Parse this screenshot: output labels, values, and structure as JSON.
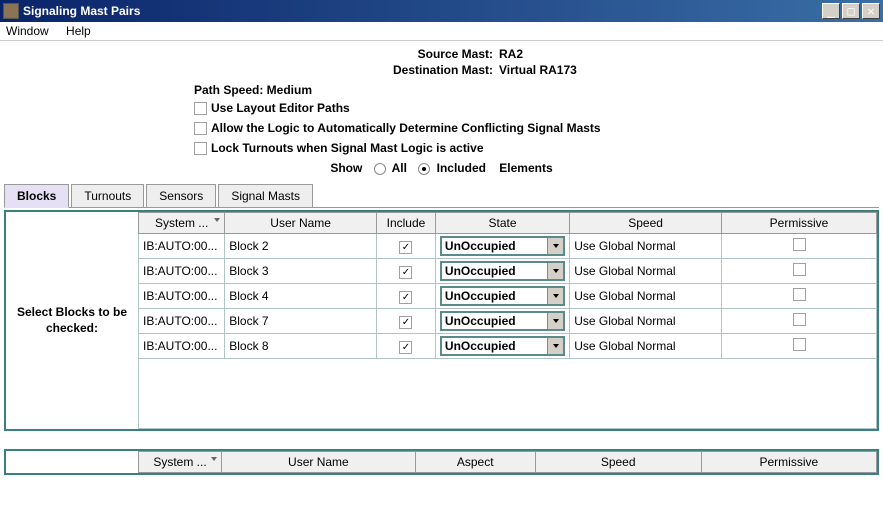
{
  "window": {
    "title": "Signaling Mast Pairs"
  },
  "menu": {
    "window": "Window",
    "help": "Help"
  },
  "header": {
    "src_label": "Source Mast:",
    "src_value": "RA2",
    "dst_label": "Destination Mast:",
    "dst_value": "Virtual RA173",
    "pathspeed": "Path Speed: Medium"
  },
  "options": {
    "useLayout": "Use Layout Editor Paths",
    "autoDetermine": "Allow the Logic to Automatically Determine Conflicting Signal Masts",
    "lockTurnouts": "Lock Turnouts when Signal Mast Logic is active"
  },
  "show": {
    "label": "Show",
    "all": "All",
    "included": "Included",
    "elements": "Elements"
  },
  "tabs": {
    "blocks": "Blocks",
    "turnouts": "Turnouts",
    "sensors": "Sensors",
    "masts": "Signal Masts"
  },
  "cols": {
    "sys": "System ...",
    "user": "User Name",
    "inc": "Include",
    "state": "State",
    "speed": "Speed",
    "perm": "Permissive",
    "aspect": "Aspect"
  },
  "sidecap": "Select Blocks to be checked:",
  "rows": [
    {
      "sys": "IB:AUTO:00...",
      "user": "Block 2",
      "state": "UnOccupied",
      "speed": "Use Global Normal"
    },
    {
      "sys": "IB:AUTO:00...",
      "user": "Block 3",
      "state": "UnOccupied",
      "speed": "Use Global Normal"
    },
    {
      "sys": "IB:AUTO:00...",
      "user": "Block 4",
      "state": "UnOccupied",
      "speed": "Use Global Normal"
    },
    {
      "sys": "IB:AUTO:00...",
      "user": "Block 7",
      "state": "UnOccupied",
      "speed": "Use Global Normal"
    },
    {
      "sys": "IB:AUTO:00...",
      "user": "Block 8",
      "state": "UnOccupied",
      "speed": "Use Global Normal"
    }
  ]
}
